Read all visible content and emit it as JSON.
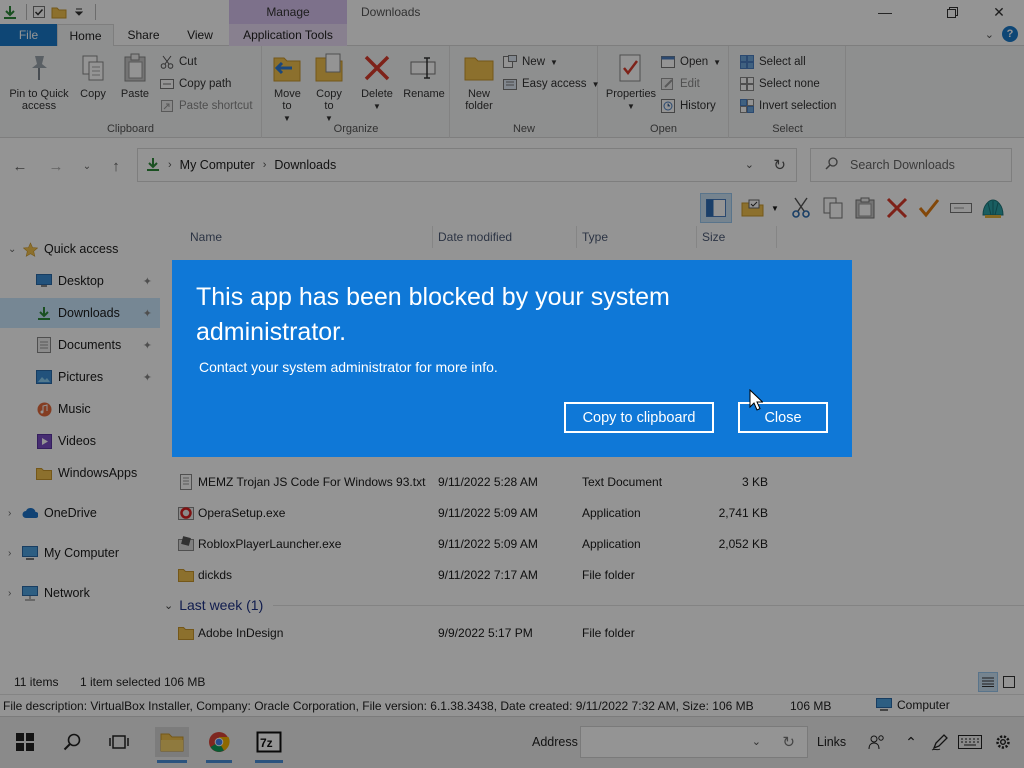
{
  "window": {
    "title": "Downloads",
    "manage_tab": "Manage"
  },
  "ribbon_tabs": {
    "file": "File",
    "home": "Home",
    "share": "Share",
    "view": "View",
    "application_tools": "Application Tools"
  },
  "ribbon": {
    "clipboard": {
      "label": "Clipboard",
      "pin": "Pin to Quick access",
      "copy": "Copy",
      "paste": "Paste",
      "cut": "Cut",
      "copy_path": "Copy path",
      "paste_shortcut": "Paste shortcut"
    },
    "organize": {
      "label": "Organize",
      "move_to": "Move to",
      "copy_to": "Copy to",
      "delete": "Delete",
      "rename": "Rename"
    },
    "new": {
      "label": "New",
      "new_folder": "New folder",
      "new_item": "New",
      "easy_access": "Easy access"
    },
    "open": {
      "label": "Open",
      "properties": "Properties",
      "open": "Open",
      "edit": "Edit",
      "history": "History"
    },
    "select": {
      "label": "Select",
      "select_all": "Select all",
      "select_none": "Select none",
      "invert": "Invert selection"
    }
  },
  "address": {
    "crumbs": [
      "My Computer",
      "Downloads"
    ],
    "search_placeholder": "Search Downloads"
  },
  "nav": {
    "quick_access": "Quick access",
    "desktop": "Desktop",
    "downloads": "Downloads",
    "documents": "Documents",
    "pictures": "Pictures",
    "music": "Music",
    "videos": "Videos",
    "windowsapps": "WindowsApps",
    "onedrive": "OneDrive",
    "my_computer": "My Computer",
    "network": "Network"
  },
  "columns": {
    "name": "Name",
    "date": "Date modified",
    "type": "Type",
    "size": "Size"
  },
  "files": [
    {
      "name": "MEMZ Trojan JS Code For Windows 93.txt",
      "date": "9/11/2022 5:28 AM",
      "type": "Text Document",
      "size": "3 KB"
    },
    {
      "name": "OperaSetup.exe",
      "date": "9/11/2022 5:09 AM",
      "type": "Application",
      "size": "2,741 KB"
    },
    {
      "name": "RobloxPlayerLauncher.exe",
      "date": "9/11/2022 5:09 AM",
      "type": "Application",
      "size": "2,052 KB"
    },
    {
      "name": "dickds",
      "date": "9/11/2022 7:17 AM",
      "type": "File folder",
      "size": ""
    }
  ],
  "group_last_week": "Last week (1)",
  "files_last_week": [
    {
      "name": "Adobe InDesign",
      "date": "9/9/2022 5:17 PM",
      "type": "File folder",
      "size": ""
    }
  ],
  "status": {
    "items": "11 items",
    "selected": "1 item selected",
    "selected_size": "106 MB"
  },
  "description": {
    "text": "File description: VirtualBox Installer, Company: Oracle Corporation, File version: 6.1.38.3438, Date created: 9/11/2022 7:32 AM, Size: 106 MB",
    "size": "106 MB",
    "location": "Computer"
  },
  "taskbar": {
    "address_label": "Address",
    "links_label": "Links"
  },
  "dialog": {
    "title": "This app has been blocked by your system administrator.",
    "message": "Contact your system administrator for more info.",
    "copy_button": "Copy to clipboard",
    "close_button": "Close"
  },
  "colors": {
    "dialog_blue": "#0f78d7",
    "file_tab": "#1979ca",
    "manage_tab": "#d8c3ef",
    "selected_nav": "#cce8ff"
  }
}
